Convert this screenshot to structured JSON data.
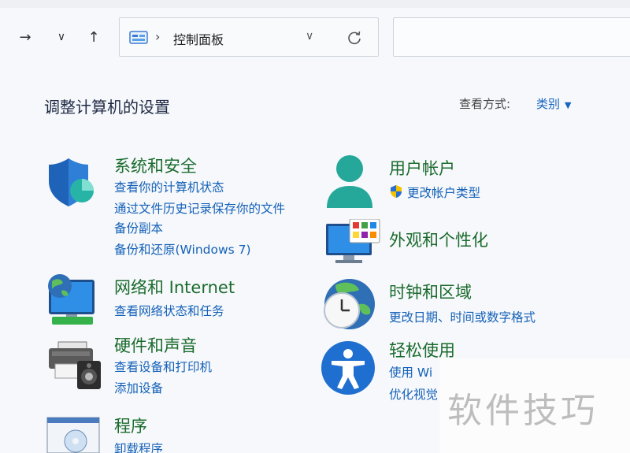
{
  "nav": {
    "back_glyph": "→",
    "recent_glyph": "∨",
    "up_glyph": "↑",
    "breadcrumb_sep": "›",
    "breadcrumb": "控制面板",
    "dropdown_glyph": "∨"
  },
  "header": {
    "title": "调整计算机的设置",
    "view_by_label": "查看方式:",
    "view_by_value": "类别"
  },
  "categories": {
    "system_security": {
      "title": "系统和安全",
      "links": [
        "查看你的计算机状态",
        "通过文件历史记录保存你的文件",
        "备份副本",
        "备份和还原(Windows 7)"
      ]
    },
    "network": {
      "title": "网络和 Internet",
      "links": [
        "查看网络状态和任务"
      ]
    },
    "hardware_sound": {
      "title": "硬件和声音",
      "links": [
        "查看设备和打印机",
        "添加设备"
      ]
    },
    "programs": {
      "title": "程序",
      "links": [
        "卸载程序"
      ]
    },
    "user_accounts": {
      "title": "用户帐户",
      "links": [
        "更改帐户类型"
      ]
    },
    "appearance": {
      "title": "外观和个性化",
      "links": []
    },
    "clock_region": {
      "title": "时钟和区域",
      "links": [
        "更改日期、时间或数字格式"
      ]
    },
    "ease_of_access": {
      "title": "轻松使用",
      "links": [
        "使用 Wi",
        "优化视觉"
      ]
    }
  },
  "watermark": "软件技巧",
  "icons": {
    "back": "arrow-right-icon",
    "recent": "chevron-down-icon",
    "up": "arrow-up-icon",
    "control_panel": "control-panel-icon",
    "refresh": "refresh-icon",
    "shield": "shield-icon",
    "network": "network-globe-icon",
    "hardware": "printer-speaker-icon",
    "programs": "programs-icon",
    "user": "user-icon",
    "uac": "uac-shield-icon",
    "appearance": "monitor-palette-icon",
    "clock": "clock-globe-icon",
    "ease": "accessibility-icon"
  },
  "colors": {
    "category_title": "#1b6b2d",
    "link": "#1461b8",
    "background": "#f6f8fb"
  }
}
